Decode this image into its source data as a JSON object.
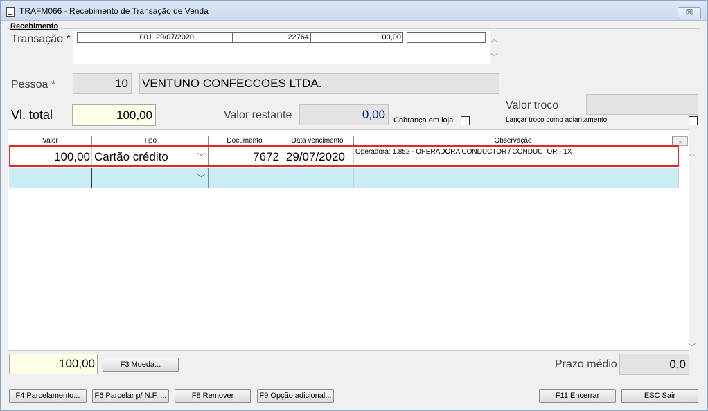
{
  "window": {
    "title": "TRAFM066 - Recebimento de Transação de Venda",
    "close": "☒"
  },
  "group": {
    "legend": "Recebimento"
  },
  "transacao": {
    "label": "Transação *",
    "cells": [
      "001",
      "29/07/2020",
      "22764",
      "100,00",
      ""
    ]
  },
  "pessoa": {
    "label": "Pessoa *",
    "code": "10",
    "name": "VENTUNO CONFECCOES LTDA."
  },
  "vl_total": {
    "label": "Vl. total",
    "value": "100,00"
  },
  "valor_restante": {
    "label": "Valor restante",
    "value": "0,00"
  },
  "cobranca": {
    "label": "Cobrança em loja"
  },
  "valor_troco": {
    "label": "Valor troco",
    "value": ""
  },
  "lancar_troco": {
    "label": "Lançar troco como adiantamento"
  },
  "grid": {
    "headers": [
      "Valor",
      "Tipo",
      "Documento",
      "Data vencimento",
      "Observação"
    ],
    "rows": [
      {
        "valor": "100,00",
        "tipo": "Cartão crédito",
        "documento": "7672",
        "data": "29/07/2020",
        "obs": "Operadora: 1.852 - OPERADORA CONDUCTOR / CONDUCTOR - 1X"
      }
    ]
  },
  "footer": {
    "total": "100,00",
    "moeda_button": "F3 Moeda...",
    "prazo_label": "Prazo médio",
    "prazo_value": "0,0"
  },
  "buttons": {
    "parcelamento": "F4 Parcelamento...",
    "parcelar_nf": "F6 Parcelar p/ N.F. ...",
    "remover": "F8 Remover",
    "opcao": "F9 Opção adicional...",
    "encerrar": "F11 Encerrar",
    "sair": "ESC Sair"
  },
  "colors": {
    "selection_outline": "#e02a2a",
    "new_row": "#c9ecf7",
    "highlight_field": "#ffffe8",
    "restante_value": "#001a8c"
  }
}
